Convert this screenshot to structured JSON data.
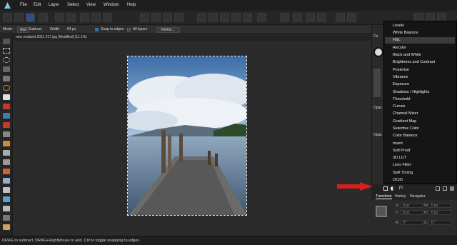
{
  "menu": [
    "File",
    "Edit",
    "Layer",
    "Select",
    "View",
    "Window",
    "Help"
  ],
  "context": {
    "mode_label": "Mode:",
    "add_label": "Add",
    "subtract_label": "Subtract",
    "width_label": "Width:",
    "width_value": "64 px",
    "snap_label": "Snap to edges",
    "all_layers_label": "All layers",
    "refine_label": "Refine..."
  },
  "document_tab": "new zealand 2011 217.jpg [Modified] (11.1%)",
  "right_panel": {
    "opacity_label": "Opac",
    "co_label": "Co"
  },
  "adjustments_menu": [
    "Levels",
    "White Balance",
    "HSL",
    "Recolor",
    "Black and White",
    "Brightness and Contrast",
    "Posterise",
    "Vibrance",
    "Exposure",
    "Shadows / Highlights",
    "Threshold",
    "Curves",
    "Channel Mixer",
    "Gradient Map",
    "Selective Color",
    "Color Balance",
    "Invert",
    "Soft Proof",
    "3D LUT",
    "Lens Filter",
    "Split Toning",
    "OCIO"
  ],
  "selected_item": "HSL",
  "panel_tabs": [
    "Transform",
    "History",
    "Navigator"
  ],
  "transform": {
    "x_label": "X:",
    "x_value": "0 px",
    "y_label": "Y:",
    "y_value": "0 px",
    "w_label": "W:",
    "w_value": "0 px",
    "h_label": "H:",
    "h_value": "0 px",
    "r_label": "R:",
    "r_value": "0 °",
    "s_label": "S:",
    "s_value": "0 °"
  },
  "status": "DRAG to subtract. DRAG+RightMouse to add. Ctrl to toggle snapping to edges",
  "colors": {
    "accent": "#d42020",
    "selected_bg": "#3c3c3c",
    "menu_bg": "#151515"
  }
}
